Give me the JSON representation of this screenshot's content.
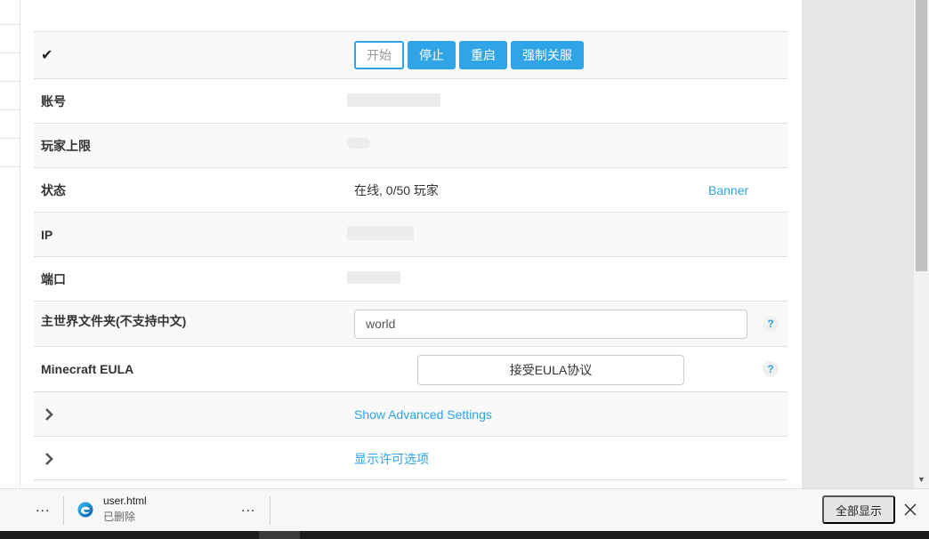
{
  "controls": {
    "start": "开始",
    "stop": "停止",
    "restart": "重启",
    "force_stop": "强制关服"
  },
  "rows": {
    "account_label": "账号",
    "player_limit_label": "玩家上限",
    "status_label": "状态",
    "status_value": "在线, 0/50 玩家",
    "banner_link": "Banner",
    "ip_label": "IP",
    "port_label": "端口",
    "world_folder_label": "主世界文件夹(不支持中文)",
    "world_folder_value": "world",
    "eula_label": "Minecraft EULA",
    "eula_button": "接受EULA协议",
    "advanced_link": "Show Advanced Settings",
    "license_link": "显示许可选项",
    "help_glyph": "?"
  },
  "download_bar": {
    "file_name": "user.html",
    "file_status": "已删除",
    "more": "...",
    "show_all": "全部显示"
  },
  "icons": {
    "check": "check-icon",
    "chevron": "chevron-right-icon",
    "browser": "edge-icon",
    "close": "close-icon"
  },
  "colors": {
    "accent": "#2fa4e7"
  }
}
